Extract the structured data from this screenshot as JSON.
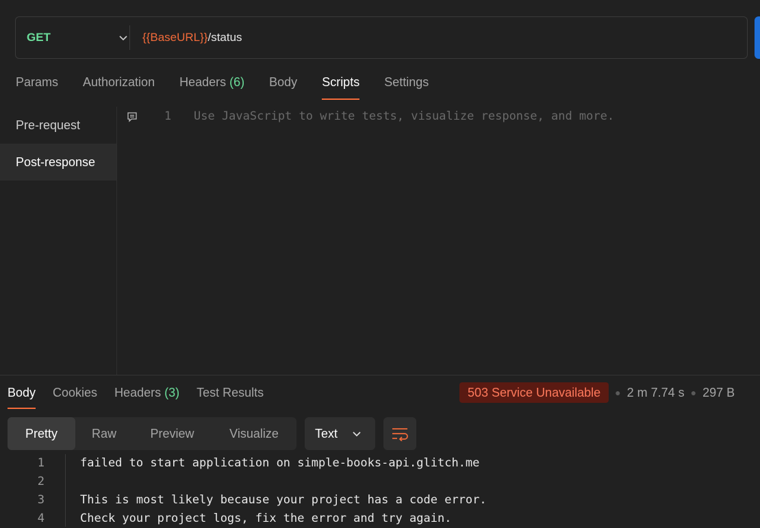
{
  "request": {
    "method": "GET",
    "url_variable": "{{BaseURL}}",
    "url_path": "/status"
  },
  "request_tabs": [
    {
      "label": "Params"
    },
    {
      "label": "Authorization"
    },
    {
      "label": "Headers",
      "count": "(6)"
    },
    {
      "label": "Body"
    },
    {
      "label": "Scripts",
      "active": true
    },
    {
      "label": "Settings"
    }
  ],
  "scripts": {
    "side_items": [
      "Pre-request",
      "Post-response"
    ],
    "selected": "Post-response",
    "editor": {
      "line_number": "1",
      "placeholder": "Use JavaScript to write tests, visualize response, and more."
    }
  },
  "response": {
    "tabs": [
      {
        "label": "Body",
        "active": true
      },
      {
        "label": "Cookies"
      },
      {
        "label": "Headers",
        "count": "(3)"
      },
      {
        "label": "Test Results"
      }
    ],
    "status": "503 Service Unavailable",
    "time": "2 m 7.74 s",
    "size": "297 B",
    "views": [
      "Pretty",
      "Raw",
      "Preview",
      "Visualize"
    ],
    "active_view": "Pretty",
    "format": "Text",
    "lines": [
      {
        "n": "1",
        "text": "failed to start application on simple-books-api.glitch.me"
      },
      {
        "n": "2",
        "text": ""
      },
      {
        "n": "3",
        "text": "This is most likely because your project has a code error."
      },
      {
        "n": "4",
        "text": "Check your project logs, fix the error and try again."
      }
    ]
  },
  "colors": {
    "background": "#212121",
    "accent": "#f26b3a",
    "method_get": "#6bdd9a",
    "status_error_bg": "#5a1a12",
    "status_error_fg": "#ff7a5c"
  }
}
